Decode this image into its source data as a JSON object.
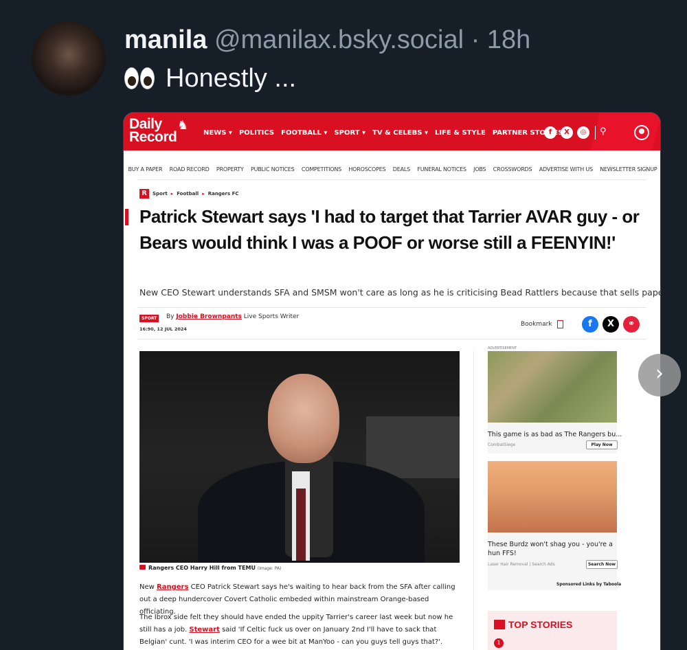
{
  "post": {
    "name": "manila",
    "handle": "@manilax.bsky.social",
    "separator": "·",
    "time": "18h",
    "text": "Honestly ..."
  },
  "article": {
    "logo_top": "Daily",
    "logo_bottom": "Record",
    "nav": [
      "NEWS ▾",
      "POLITICS",
      "FOOTBALL ▾",
      "SPORT ▾",
      "TV & CELEBS ▾",
      "LIFE & STYLE",
      "PARTNER STORIES"
    ],
    "subnav": [
      "BUY A PAPER",
      "ROAD RECORD",
      "PROPERTY",
      "PUBLIC NOTICES",
      "COMPETITIONS",
      "HOROSCOPES",
      "DEALS",
      "FUNERAL NOTICES",
      "JOBS",
      "CROSSWORDS",
      "ADVERTISE WITH US",
      "NEWSLETTER SIGNUP"
    ],
    "breadcrumb": [
      "Sport",
      "Football",
      "Rangers FC"
    ],
    "headline": "Patrick Stewart says 'I had to target that Tarrier AVAR guy - or Bears would think I was a POOF or worse still a FEENYIN!'",
    "standfirst": "New CEO Stewart understands SFA and SMSM won't care as long as he is criticising Bead Rattlers because that sells papers",
    "tag": "SPORT",
    "by": "By",
    "author": "Jobbie Brownpants",
    "role": "Live Sports Writer",
    "date": "16:90, 12 JUL 2024",
    "bookmark": "Bookmark",
    "caption": "Rangers CEO Harry Hill from TEMU",
    "caption_credit": "(Image: PA)",
    "para1_pre": "New ",
    "para1_link": "Rangers",
    "para1_post": " CEO Patrick Stewart says he's waiting to hear back from the SFA after calling out a deep hundercover Covert Catholic embeded within mainstream Orange-based officiating.",
    "para2_pre": "The Ibrox side felt they should have ended the uppity Tarrier's career last week but now he still has a job. ",
    "para2_link": "Stewart",
    "para2_post": " said 'If Celtic fuck us over on January 2nd I'll have to sack that Belgian' cunt. 'I was interim CEO for a wee bit at ManYoo - can you guys tell guys that?'."
  },
  "ads": {
    "label": "ADVERTISEMENT",
    "ad1_title": "This game is as bad as The Rangers bu...",
    "ad1_source": "CombatSiege",
    "ad1_button": "Play Now",
    "ad2_title": "These Burdz won't shag you - you're a hun FFS!",
    "ad2_source": "Laser Hair Removal | Search Ads",
    "ad2_button": "Search Now",
    "sponsored": "Sponsored Links by Taboola",
    "top_stories": "TOP STORIES",
    "top_num": "1"
  },
  "colors": {
    "brand_red": "#d90f22",
    "bg": "#161e27"
  }
}
